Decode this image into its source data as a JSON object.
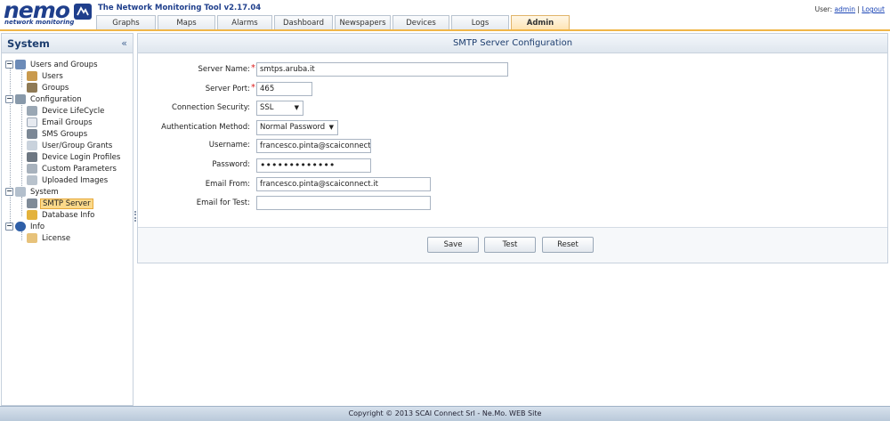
{
  "header": {
    "logo_text": "nemo",
    "logo_sub": "network monitoring",
    "app_title": "The Network Monitoring Tool v2.17.04",
    "user_label": "User:",
    "user_name": "admin",
    "separator": "|",
    "logout": "Logout",
    "tabs": [
      {
        "label": "Graphs",
        "active": false
      },
      {
        "label": "Maps",
        "active": false
      },
      {
        "label": "Alarms",
        "active": false
      },
      {
        "label": "Dashboard",
        "active": false
      },
      {
        "label": "Newspapers",
        "active": false
      },
      {
        "label": "Devices",
        "active": false
      },
      {
        "label": "Logs",
        "active": false
      },
      {
        "label": "Admin",
        "active": true
      }
    ]
  },
  "sidebar": {
    "title": "System",
    "collapse_glyph": "«",
    "tree": [
      {
        "label": "Users and Groups",
        "icon": "users-groups-icon",
        "expander": "−"
      },
      {
        "label": "Users",
        "icon": "user-icon"
      },
      {
        "label": "Groups",
        "icon": "group-icon"
      },
      {
        "label": "Configuration",
        "icon": "configuration-icon",
        "expander": "−"
      },
      {
        "label": "Device LifeCycle",
        "icon": "device-lifecycle-icon"
      },
      {
        "label": "Email Groups",
        "icon": "email-icon"
      },
      {
        "label": "SMS Groups",
        "icon": "sms-icon"
      },
      {
        "label": "User/Group Grants",
        "icon": "grants-icon"
      },
      {
        "label": "Device Login Profiles",
        "icon": "login-profile-icon"
      },
      {
        "label": "Custom Parameters",
        "icon": "parameters-icon"
      },
      {
        "label": "Uploaded Images",
        "icon": "images-icon"
      },
      {
        "label": "System",
        "icon": "system-icon",
        "expander": "−"
      },
      {
        "label": "SMTP Server",
        "icon": "smtp-server-icon",
        "selected": true
      },
      {
        "label": "Database Info",
        "icon": "database-icon"
      },
      {
        "label": "Info",
        "icon": "info-icon",
        "expander": "−"
      },
      {
        "label": "License",
        "icon": "license-icon"
      }
    ]
  },
  "form": {
    "title": "SMTP Server Configuration",
    "required_mark": "*",
    "server_name": {
      "label": "Server Name:",
      "value": "smtps.aruba.it"
    },
    "server_port": {
      "label": "Server Port:",
      "value": "465"
    },
    "security": {
      "label": "Connection Security:",
      "value": "SSL"
    },
    "auth": {
      "label": "Authentication Method:",
      "value": "Normal Password"
    },
    "username": {
      "label": "Username:",
      "value": "francesco.pinta@scaiconnect."
    },
    "password": {
      "label": "Password:",
      "value": "•••••••••••••"
    },
    "email_from": {
      "label": "Email From:",
      "value": "francesco.pinta@scaiconnect.it"
    },
    "email_test": {
      "label": "Email for Test:",
      "value": ""
    },
    "buttons": {
      "save": "Save",
      "test": "Test",
      "reset": "Reset"
    },
    "dropdown_arrow": "▼"
  },
  "footer": {
    "text": "Copyright © 2013 SCAI Connect Srl - Ne.Mo. WEB Site"
  },
  "colors": {
    "accent": "#f0b649",
    "brand": "#1f3f8c",
    "selection": "#fbd98a"
  }
}
